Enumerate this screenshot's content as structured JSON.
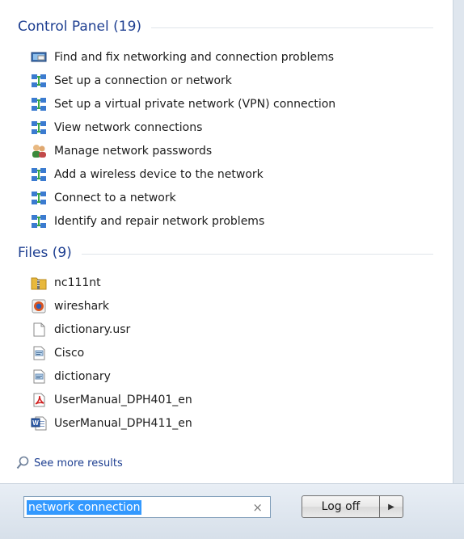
{
  "control_panel": {
    "title": "Control Panel (19)",
    "items": [
      {
        "label": "Find and fix networking and connection problems",
        "icon": "troubleshoot-icon"
      },
      {
        "label": "Set up a connection or network",
        "icon": "network-icon"
      },
      {
        "label": "Set up a virtual private network (VPN) connection",
        "icon": "network-icon"
      },
      {
        "label": "View network connections",
        "icon": "network-icon"
      },
      {
        "label": "Manage network passwords",
        "icon": "users-icon"
      },
      {
        "label": "Add a wireless device to the network",
        "icon": "network-icon"
      },
      {
        "label": "Connect to a network",
        "icon": "network-icon"
      },
      {
        "label": "Identify and repair network problems",
        "icon": "network-icon"
      }
    ]
  },
  "files": {
    "title": "Files (9)",
    "items": [
      {
        "label": "nc111nt",
        "icon": "zip-folder-icon"
      },
      {
        "label": "wireshark",
        "icon": "wireshark-icon"
      },
      {
        "label": "dictionary.usr",
        "icon": "blank-file-icon"
      },
      {
        "label": "Cisco",
        "icon": "text-file-icon"
      },
      {
        "label": "dictionary",
        "icon": "text-file-icon"
      },
      {
        "label": "UserManual_DPH401_en",
        "icon": "pdf-icon"
      },
      {
        "label": "UserManual_DPH411_en",
        "icon": "word-doc-icon"
      }
    ]
  },
  "see_more": {
    "label": "See more results",
    "icon": "search-icon"
  },
  "search": {
    "value": "network connection",
    "clear_glyph": "×"
  },
  "power": {
    "logoff_label": "Log off",
    "arrow_glyph": "▶"
  }
}
